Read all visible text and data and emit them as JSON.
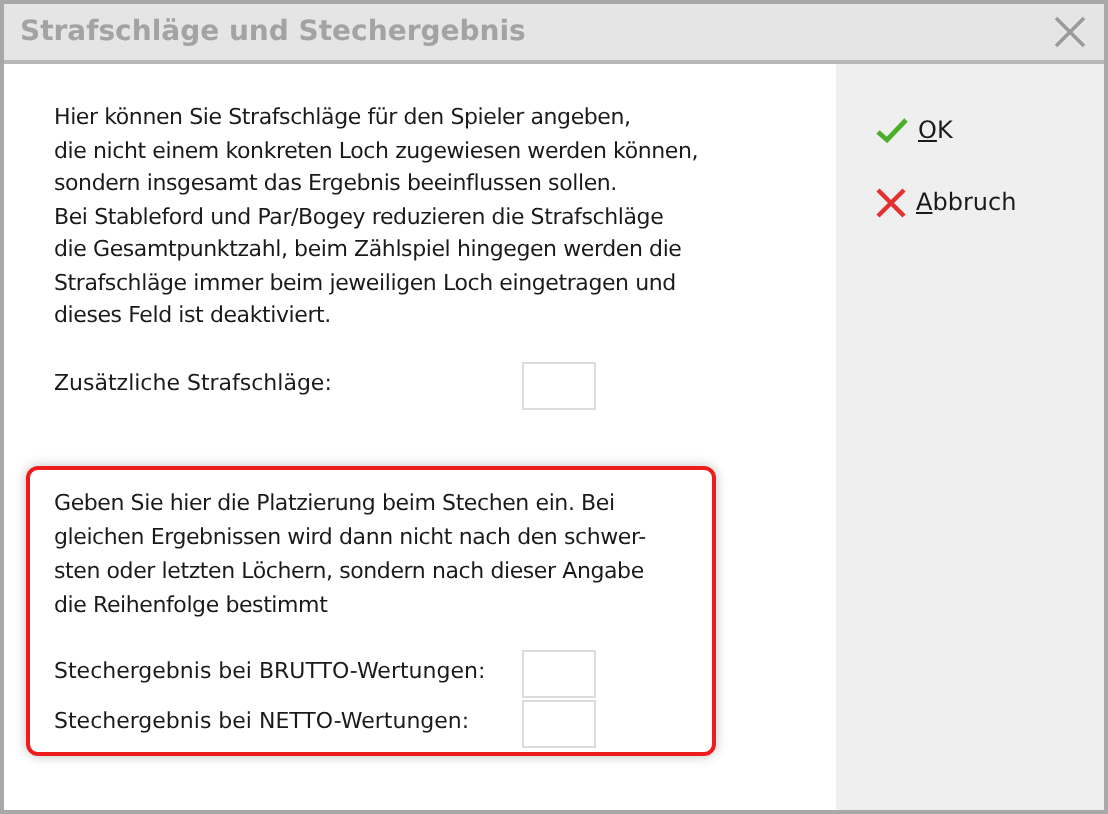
{
  "window": {
    "title": "Strafschläge und Stechergebnis"
  },
  "intro": {
    "lines": [
      "Hier können Sie Strafschläge für den Spieler angeben,",
      "die nicht einem konkreten Loch zugewiesen werden können,",
      "sondern insgesamt das Ergebnis beeinflussen sollen.",
      "Bei Stableford und Par/Bogey reduzieren die Strafschläge",
      "die Gesamtpunktzahl, beim Zählspiel hingegen werden die",
      "Strafschläge immer beim jeweiligen Loch eingetragen und",
      "dieses Feld ist deaktiviert."
    ]
  },
  "penalty_field": {
    "label": "Zusätzliche Strafschläge:"
  },
  "tiebreak": {
    "lines": [
      "Geben Sie hier die Platzierung beim Stechen ein. Bei",
      "gleichen Ergebnissen wird dann nicht nach den schwer-",
      "sten oder letzten Löchern, sondern nach dieser Angabe",
      "die Reihenfolge bestimmt"
    ],
    "fields": [
      {
        "label": "Stechergebnis bei BRUTTO-Wertungen:"
      },
      {
        "label": "Stechergebnis bei NETTO-Wertungen:"
      }
    ]
  },
  "buttons": [
    {
      "kind": "ok",
      "label": "OK",
      "first_letter_underlined": true
    },
    {
      "kind": "cancel",
      "label": "Abbruch",
      "first_letter_underlined": true
    }
  ]
}
